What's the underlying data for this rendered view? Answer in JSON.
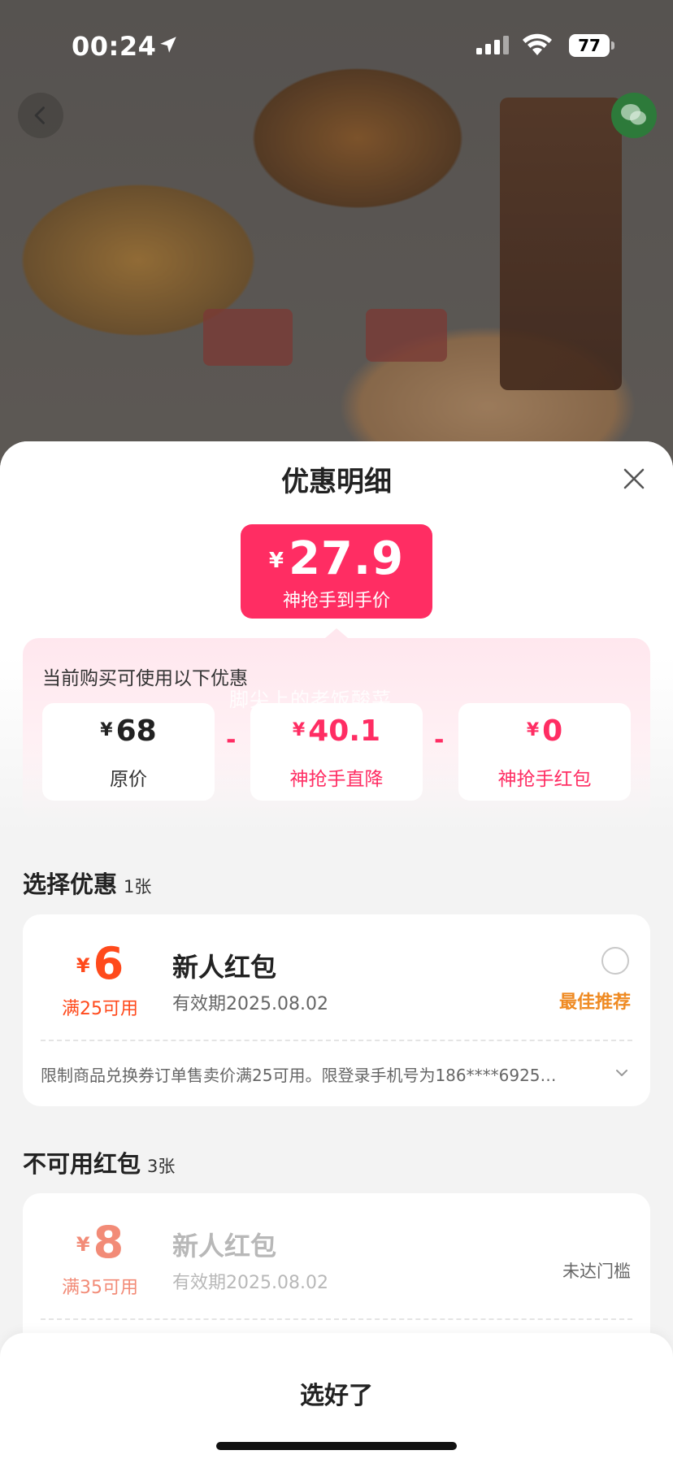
{
  "status_bar": {
    "time": "00:24",
    "battery": "77",
    "icons": [
      "location-arrow-icon",
      "signal-icon",
      "wifi-icon",
      "battery-icon"
    ]
  },
  "nav": {
    "back_icon": "chevron-left-icon",
    "share_icon": "wechat-icon"
  },
  "sheet": {
    "title": "优惠明细",
    "close_icon": "close-icon",
    "final_price": {
      "currency": "¥",
      "amount": "27.9",
      "label": "神抢手到手价"
    },
    "breakdown": {
      "label": "当前购买可使用以下优惠",
      "watermark": "脚尖上的老饭酸菜",
      "operator": "-",
      "items": [
        {
          "currency": "¥",
          "value": "68",
          "label": "原价"
        },
        {
          "currency": "¥",
          "value": "40.1",
          "label": "神抢手直降"
        },
        {
          "currency": "¥",
          "value": "0",
          "label": "神抢手红包"
        }
      ]
    },
    "select_section": {
      "title": "选择优惠",
      "count": "1张",
      "coupon": {
        "currency": "¥",
        "amount": "6",
        "condition": "满25可用",
        "name": "新人红包",
        "expiry": "有效期2025.08.02",
        "tag": "最佳推荐",
        "restriction": "限制商品兑换券订单售卖价满25可用。限登录手机号为186****6925…",
        "selected": false
      }
    },
    "unavailable_section": {
      "title": "不可用红包",
      "count": "3张",
      "coupon": {
        "currency": "¥",
        "amount": "8",
        "condition": "满35可用",
        "name": "新人红包",
        "expiry": "有效期2025.08.02",
        "reason": "未达门槛"
      }
    },
    "confirm_label": "选好了"
  },
  "colors": {
    "accent_pink": "#ff2d63",
    "coupon_red": "#ff4a1c",
    "recommend_orange": "#ef8a22",
    "disabled_red": "#f28b77"
  }
}
